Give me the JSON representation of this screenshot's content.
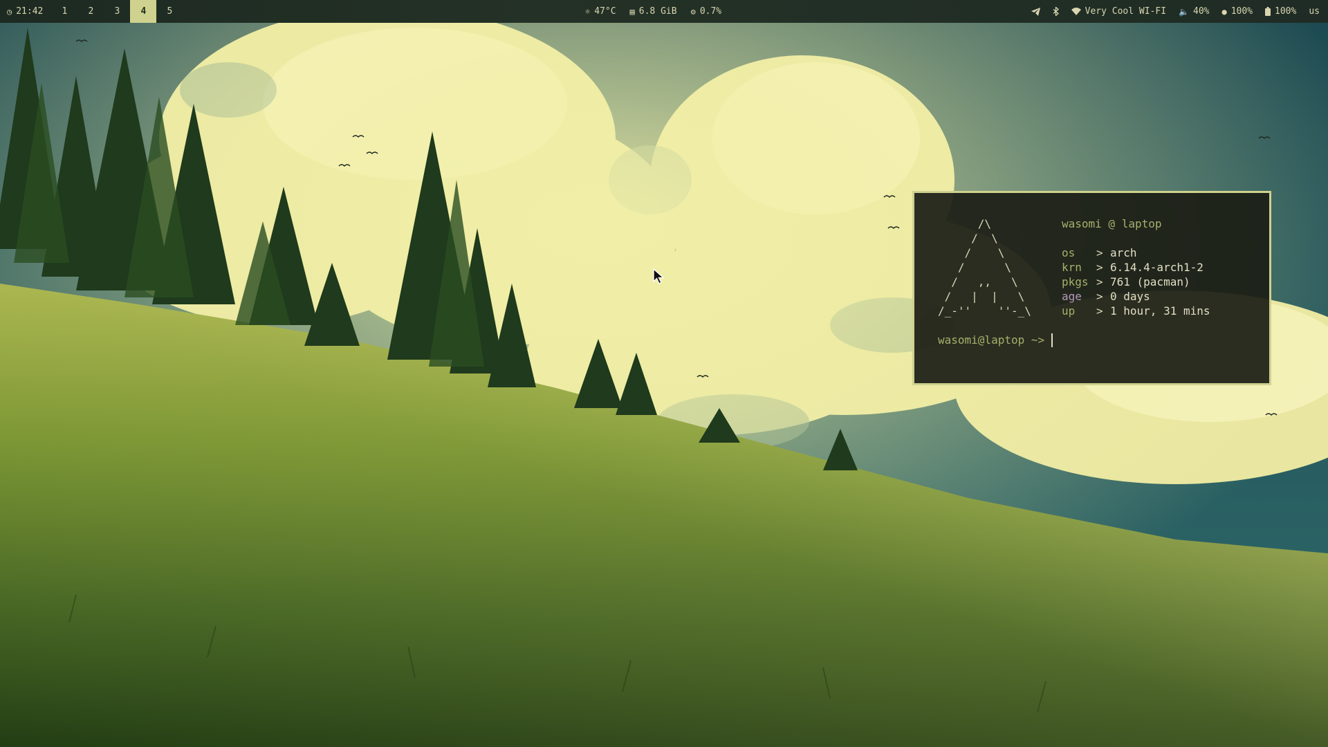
{
  "topbar": {
    "clock": {
      "icon": "clock-icon",
      "time": "21:42"
    },
    "workspaces": [
      {
        "label": "1",
        "active": false
      },
      {
        "label": "2",
        "active": false
      },
      {
        "label": "3",
        "active": false
      },
      {
        "label": "4",
        "active": true
      },
      {
        "label": "5",
        "active": false
      }
    ],
    "temperature": {
      "icon": "sun-icon",
      "value": "47°C"
    },
    "memory": {
      "icon": "memory-icon",
      "value": "6.8 GiB"
    },
    "cpu": {
      "icon": "cpu-icon",
      "value": "0.7%"
    },
    "telegram": {
      "icon": "telegram-icon"
    },
    "bluetooth": {
      "icon": "bluetooth-icon"
    },
    "wifi": {
      "icon": "wifi-icon",
      "value": "Very Cool WI-FI"
    },
    "volume": {
      "icon": "speaker-icon",
      "value": "40%"
    },
    "brightness": {
      "icon": "circle-icon",
      "value": "100%"
    },
    "battery": {
      "icon": "battery-icon",
      "value": "100%"
    },
    "keyboard_layout": "us"
  },
  "terminal": {
    "ascii_art": "      /\\\n     /  \\\n    /    \\\n   /      \\\n  /   ,,   \\\n /   |  |   \\\n/_-''    ''-_\\",
    "title": "wasomi @ laptop",
    "info": [
      {
        "key": "os",
        "value": "arch"
      },
      {
        "key": "krn",
        "value": "6.14.4-arch1-2"
      },
      {
        "key": "pkgs",
        "value": "761 (pacman)"
      },
      {
        "key": "age",
        "value": "0 days"
      },
      {
        "key": "up",
        "value": "1 hour, 31 mins"
      }
    ],
    "arrow": ">",
    "prompt": "wasomi@laptop ~>"
  },
  "colors": {
    "bar_bg": "#1f2c25",
    "bar_fg": "#d8d5b0",
    "accent": "#cfd28e",
    "terminal_bg": "#1c1e16",
    "terminal_key": "#a6b06c"
  }
}
